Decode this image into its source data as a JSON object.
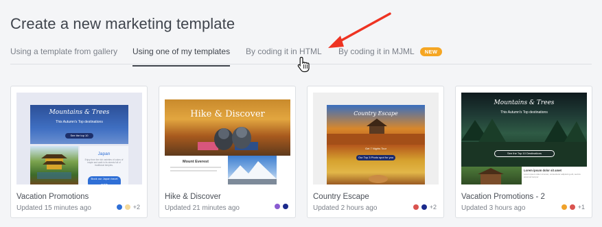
{
  "page": {
    "title": "Create a new marketing template"
  },
  "tabs": [
    {
      "label": "Using a template from gallery",
      "active": false
    },
    {
      "label": "Using one of my templates",
      "active": true
    },
    {
      "label": "By coding it in HTML",
      "active": false
    },
    {
      "label": "By coding it in MJML",
      "active": false,
      "badge": "NEW"
    }
  ],
  "templates": [
    {
      "name": "Vacation Promotions",
      "updated": "Updated 15 minutes ago",
      "colors": [
        "#2f6fd6",
        "#f3d99b"
      ],
      "more_colors": "+2",
      "thumbnail": {
        "heading": "Mountains & Trees",
        "subheading": "This Autumn's Top destinations",
        "button": "See the top 10",
        "side_title": "Japan",
        "side_text": "Enjoy from the rich varieties of colors of maple and walk in its streets full of traditional temples.",
        "side_button": "Book our Japan travel guide"
      }
    },
    {
      "name": "Hike & Discover",
      "updated": "Updated 21 minutes ago",
      "colors": [
        "#8a5bd1",
        "#1b2a8c"
      ],
      "more_colors": "",
      "thumbnail": {
        "heading": "Hike & Discover",
        "caption": "Mount Everest"
      }
    },
    {
      "name": "Country Escape",
      "updated": "Updated 2 hours ago",
      "colors": [
        "#d9534f",
        "#1b2a8c"
      ],
      "more_colors": "+2",
      "thumbnail": {
        "heading": "Country Escape",
        "subheading": "Get 7 Nights Tour",
        "button": "Our Top 3 Photo spot for you"
      }
    },
    {
      "name": "Vacation Promotions - 2",
      "updated": "Updated 3 hours ago",
      "colors": [
        "#f0a22b",
        "#d9534f"
      ],
      "more_colors": "+1",
      "thumbnail": {
        "heading": "Mountains & Trees",
        "subheading": "This Autumn's Top destinations",
        "button": "See the Top 10 Destinations",
        "side_title": "Lorem ipsum dolor sit amet",
        "side_text": "Lorem ipsum dolor sit amet, consectetur adipiscing elit, sed do eiusmod tempor"
      }
    }
  ]
}
